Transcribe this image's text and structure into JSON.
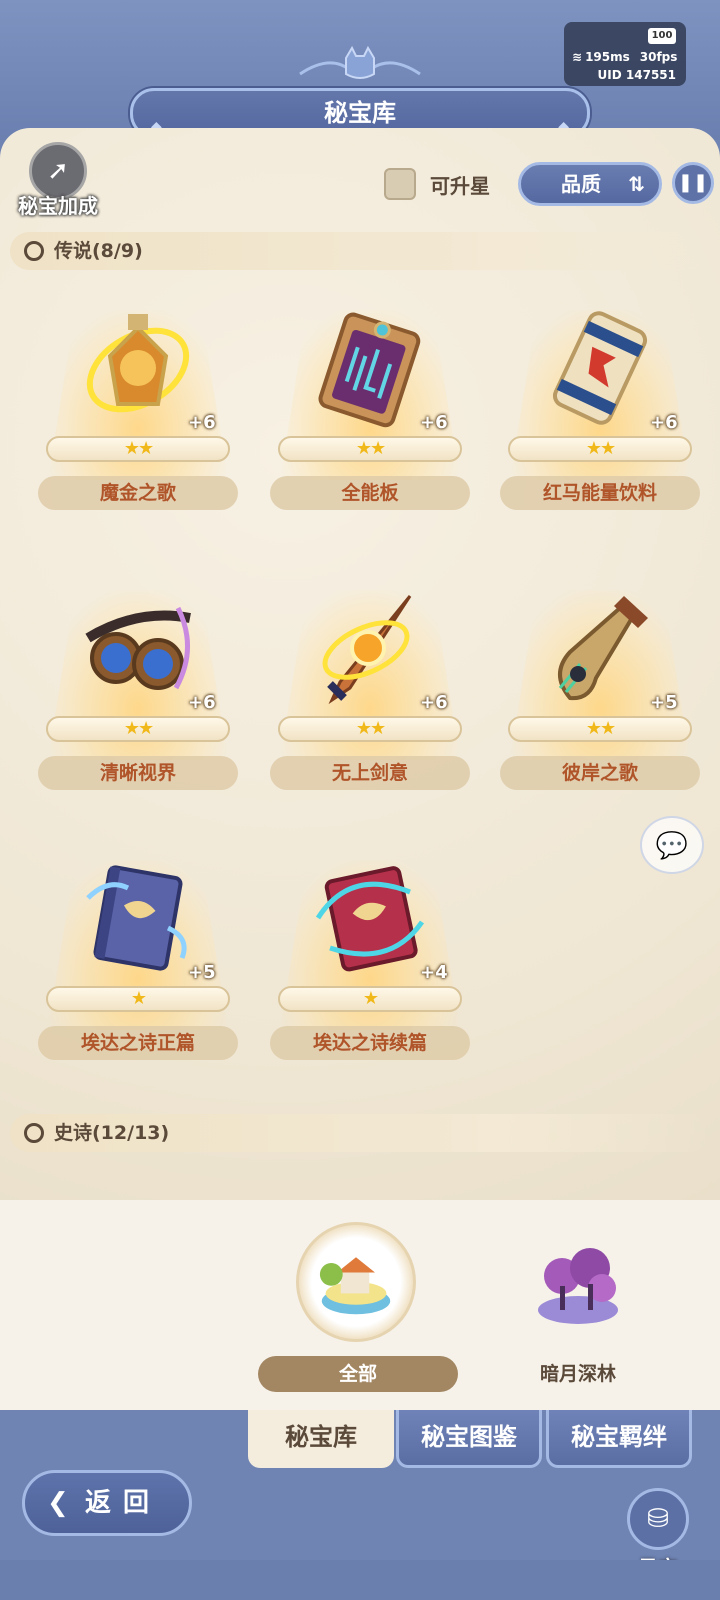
{
  "status": {
    "battery": "100",
    "ping": "195ms",
    "fps": "30fps",
    "uid": "UID 147551"
  },
  "header": {
    "title": "秘宝库"
  },
  "toolbar": {
    "bonus_label": "秘宝加成",
    "upgradable_label": "可升星",
    "sort_label": "品质"
  },
  "sections": [
    {
      "title": "传说(8/9)",
      "items": [
        {
          "name": "魔金之歌",
          "level": "+6",
          "stars": "★★"
        },
        {
          "name": "全能板",
          "level": "+6",
          "stars": "★★"
        },
        {
          "name": "红马能量饮料",
          "level": "+6",
          "stars": "★★"
        },
        {
          "name": "清晰视界",
          "level": "+6",
          "stars": "★★"
        },
        {
          "name": "无上剑意",
          "level": "+6",
          "stars": "★★"
        },
        {
          "name": "彼岸之歌",
          "level": "+5",
          "stars": "★★"
        },
        {
          "name": "埃达之诗正篇",
          "level": "+5",
          "stars": "★"
        },
        {
          "name": "埃达之诗续篇",
          "level": "+4",
          "stars": "★"
        }
      ]
    },
    {
      "title": "史诗(12/13)"
    }
  ],
  "regions": [
    {
      "label": "全部"
    },
    {
      "label": "暗月深林"
    }
  ],
  "tabs": [
    {
      "label": "秘宝库"
    },
    {
      "label": "秘宝图鉴"
    },
    {
      "label": "秘宝羁绊"
    }
  ],
  "nav": {
    "back_label": "返回",
    "hunt_label": "寻宝"
  },
  "colors": {
    "frame_blue": "#6f84b3",
    "parchment": "#f3ead8",
    "item_name": "#b0542a",
    "star": "#f0b818"
  }
}
